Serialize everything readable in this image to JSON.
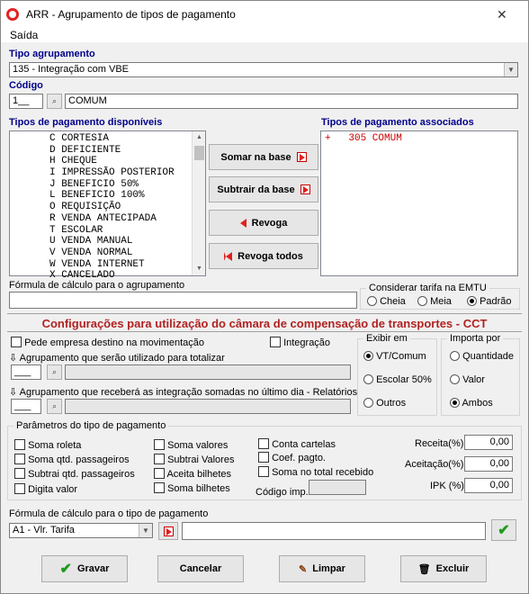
{
  "window": {
    "title": "ARR - Agrupamento de tipos de pagamento",
    "close_icon": "close-icon"
  },
  "menu": {
    "saida": "Saída"
  },
  "tipo_agrupamento": {
    "label": "Tipo agrupamento",
    "value": "135 - Integração com VBE"
  },
  "codigo": {
    "label": "Código",
    "code": "1__",
    "name": "COMUM"
  },
  "disponiveis": {
    "label": "Tipos de pagamento disponíveis",
    "items": [
      "C CORTESIA",
      "D DEFICIENTE",
      "H CHEQUE",
      "I IMPRESSÃO POSTERIOR",
      "J BENEFICIO 50%",
      "L BENEFICIO 100%",
      "O REQUISIÇÃO",
      "R VENDA ANTECIPADA",
      "T ESCOLAR",
      "U VENDA MANUAL",
      "V VENDA NORMAL",
      "W VENDA INTERNET",
      "X CANCELADO"
    ]
  },
  "associados": {
    "label": "Tipos de pagamento associados",
    "items": [
      "+   305 COMUM"
    ]
  },
  "buttons": {
    "somar": "Somar  na base",
    "subtrair": "Subtrair da base",
    "revoga": "Revoga",
    "revoga_todos": "Revoga todos"
  },
  "formula_agrup": {
    "label": "Fórmula de cálculo para o agrupamento",
    "value": ""
  },
  "tarifa": {
    "label": "Considerar tarifa na EMTU",
    "options": [
      "Cheia",
      "Meia",
      "Padrão"
    ],
    "selected": "Padrão"
  },
  "banner": "Configurações para utilização do câmara de compensação de transportes - CCT",
  "cct": {
    "pede_empresa": "Pede empresa destino na movimentação",
    "integracao": "Integração",
    "agrup_totalizar": "Agrupamento que serão utilizado para totalizar",
    "agrup_totalizar_code": "___",
    "agrup_integracao": "Agrupamento que receberá as integração somadas no último dia - Relatórios",
    "agrup_integracao_code": "___"
  },
  "exibir": {
    "label": "Exibir em",
    "options": [
      "VT/Comum",
      "Escolar 50%",
      "Outros"
    ],
    "selected": "VT/Comum"
  },
  "importa": {
    "label": "Importa por",
    "options": [
      "Quantidade",
      "Valor",
      "Ambos"
    ],
    "selected": "Ambos"
  },
  "parametros": {
    "label": "Parâmetros do tipo de pagamento",
    "col1": [
      "Soma roleta",
      "Soma qtd. passageiros",
      "Subtrai qtd. passageiros",
      "Digita valor"
    ],
    "col2": [
      "Soma valores",
      "Subtrai Valores",
      "Aceita bilhetes",
      "Soma bilhetes"
    ],
    "col3": [
      "Conta cartelas",
      "Coef. pagto.",
      "Soma no total recebido"
    ],
    "codigo_imp": "Código imp.",
    "receita_label": "Receita(%)",
    "receita": "0,00",
    "aceitacao_label": "Aceitação(%)",
    "aceitacao": "0,00",
    "ipk_label": "IPK (%)",
    "ipk": "0,00"
  },
  "formula_tipo": {
    "label": "Fórmula de cálculo para o tipo de pagamento",
    "value": "A1 - Vlr. Tarifa"
  },
  "footer": {
    "gravar": "Gravar",
    "cancelar": "Cancelar",
    "limpar": "Limpar",
    "excluir": "Excluir"
  },
  "colors": {
    "accent_blue": "#00008b",
    "banner_red": "#b22222",
    "list_red": "#cc0000"
  }
}
